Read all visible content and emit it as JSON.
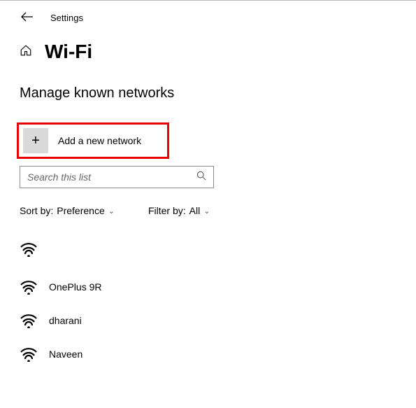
{
  "header": {
    "settings_label": "Settings"
  },
  "page": {
    "title": "Wi-Fi",
    "subtitle": "Manage known networks"
  },
  "add_network": {
    "label": "Add a new network"
  },
  "search": {
    "placeholder": "Search this list"
  },
  "filters": {
    "sort_label": "Sort by:",
    "sort_value": "Preference",
    "filter_label": "Filter by:",
    "filter_value": "All"
  },
  "networks": [
    {
      "name": ""
    },
    {
      "name": "OnePlus 9R"
    },
    {
      "name": "dharani"
    },
    {
      "name": "Naveen"
    }
  ]
}
